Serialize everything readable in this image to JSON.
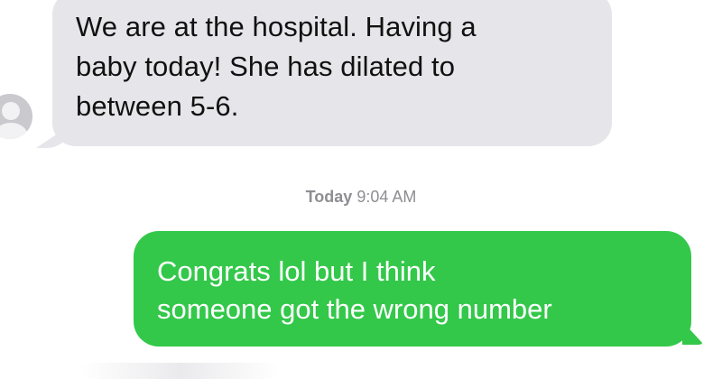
{
  "conversation": {
    "incoming": {
      "lines": [
        "We are at the hospital. Having a",
        "baby today! She has dilated to",
        "between 5-6."
      ]
    },
    "timestamp": {
      "day": "Today",
      "time": "9:04 AM"
    },
    "outgoing": {
      "lines": [
        "Congrats lol but I think",
        "someone got the wrong number"
      ]
    }
  },
  "colors": {
    "incoming_bubble": "#e6e5ea",
    "outgoing_bubble": "#33c84a",
    "timestamp_text": "#8e8e93"
  },
  "icons": {
    "contact_avatar": "person-silhouette-icon"
  }
}
